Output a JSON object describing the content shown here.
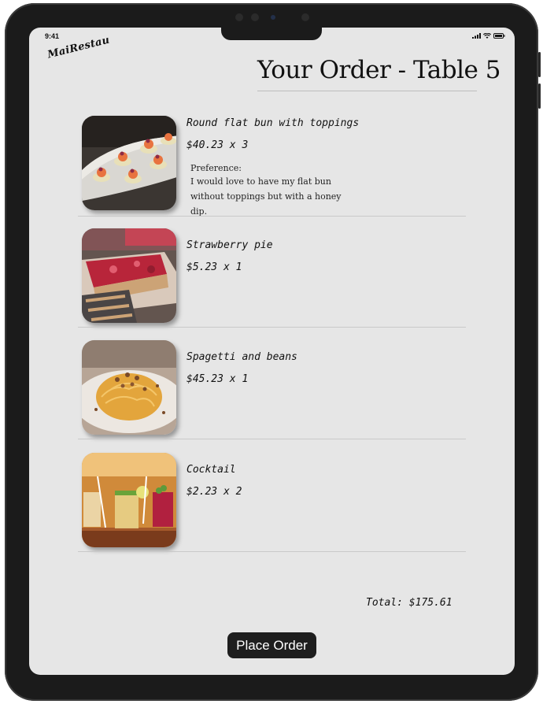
{
  "status": {
    "time": "9:41",
    "icons": [
      "signal-icon",
      "wifi-icon",
      "battery-icon"
    ]
  },
  "brand": {
    "logo_text": "MaiRestau"
  },
  "header": {
    "title": "Your Order - Table 5"
  },
  "order_items": [
    {
      "name": "Round flat bun with toppings",
      "price": "$40.23 x 3",
      "preference_label": "Preference:",
      "preference_text": "I would love to have my flat bun without toppings but with a honey dip.",
      "image": "flat-bun-photo"
    },
    {
      "name": "Strawberry pie",
      "price": "$5.23 x 1",
      "image": "strawberry-pie-photo"
    },
    {
      "name": "Spagetti and beans",
      "price": "$45.23 x 1",
      "image": "spaghetti-photo"
    },
    {
      "name": "Cocktail",
      "price": "$2.23 x 2",
      "image": "cocktail-photo"
    }
  ],
  "summary": {
    "total": "Total: $175.61"
  },
  "actions": {
    "place_order_label": "Place Order"
  },
  "colors": {
    "screen_bg": "#e6e6e6",
    "device_frame": "#1b1b1b",
    "button_bg": "#1e1e1e",
    "button_text": "#ffffff"
  }
}
